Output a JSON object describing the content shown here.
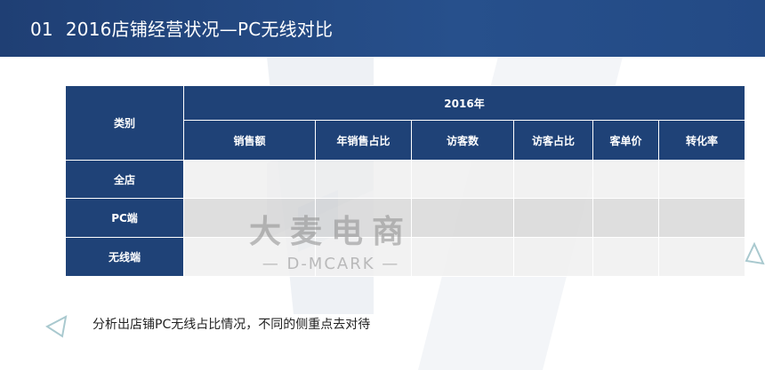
{
  "header": {
    "number": "01",
    "title": "2016店铺经营状况—PC无线对比"
  },
  "table": {
    "corner_label": "类别",
    "year_label": "2016年",
    "columns": [
      "销售额",
      "年销售占比",
      "访客数",
      "访客占比",
      "客单价",
      "转化率"
    ],
    "rows": [
      "全店",
      "PC端",
      "无线端"
    ]
  },
  "watermark": {
    "cn": "大麦电商",
    "en": "— D-MCARK —"
  },
  "note": "分析出店铺PC无线占比情况，不同的侧重点去对待",
  "colors": {
    "header_bg": "#1f3f74",
    "table_header": "#1f4277",
    "row_light": "#f0f0f0",
    "row_dark": "#d8d8d8"
  }
}
